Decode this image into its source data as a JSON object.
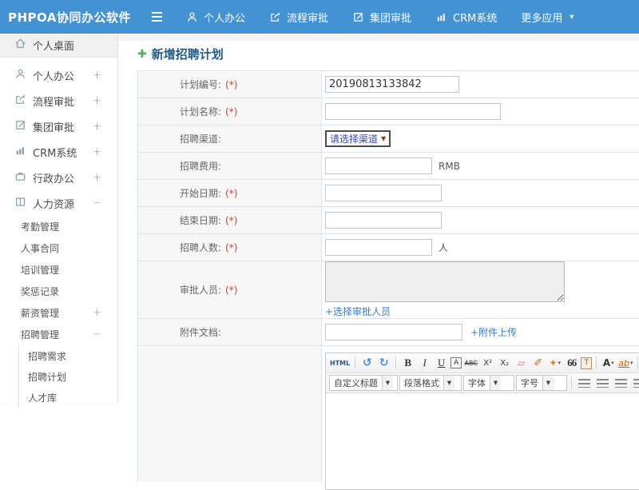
{
  "colors": {
    "topbar": "#4292d4",
    "link": "#3a7cc4",
    "title": "#235c88",
    "green": "#52b152",
    "required": "#e5342a"
  },
  "topbar": {
    "brand": "PHPOA协同办公软件",
    "items": [
      {
        "label": "个人办公"
      },
      {
        "label": "流程审批"
      },
      {
        "label": "集团审批"
      },
      {
        "label": "CRM系统"
      },
      {
        "label": "更多应用",
        "caret": "▾"
      }
    ]
  },
  "sidebar": {
    "items": [
      {
        "label": "个人桌面"
      },
      {
        "label": "个人办公",
        "expander": "+"
      },
      {
        "label": "流程审批",
        "expander": "+"
      },
      {
        "label": "集团审批",
        "expander": "+"
      },
      {
        "label": "CRM系统",
        "expander": "+"
      },
      {
        "label": "行政办公",
        "expander": "+"
      },
      {
        "label": "人力资源",
        "expander": "−"
      },
      {
        "label": "考勤管理"
      },
      {
        "label": "人事合同"
      },
      {
        "label": "培训管理"
      },
      {
        "label": "奖惩记录"
      },
      {
        "label": "薪资管理",
        "expander": "+"
      },
      {
        "label": "招聘管理",
        "expander": "−"
      },
      {
        "label": "招聘需求"
      },
      {
        "label": "招聘计划"
      },
      {
        "label": "人才库"
      }
    ]
  },
  "page": {
    "title": "新增招聘计划"
  },
  "form": {
    "required_mark": "(*)",
    "rows": [
      {
        "label": "计划编号:",
        "value": "20190813133842"
      },
      {
        "label": "计划名称:",
        "value": ""
      },
      {
        "label": "招聘渠道:",
        "select_value": "请选择渠道",
        "select_arrow": "▼"
      },
      {
        "label": "招聘费用:",
        "value": "",
        "suffix": "RMB"
      },
      {
        "label": "开始日期:",
        "value": ""
      },
      {
        "label": "结束日期:",
        "value": ""
      },
      {
        "label": "招聘人数:",
        "value": "",
        "suffix": "人"
      },
      {
        "label": "审批人员:",
        "link": "+选择审批人员"
      },
      {
        "label": "附件文档:",
        "value": "",
        "link": "+附件上传"
      }
    ]
  },
  "editor": {
    "row1": {
      "html": "HTML",
      "undo": "↺",
      "redo": "↻",
      "bold": "B",
      "italic": "I",
      "underline": "U",
      "border": "A",
      "strike": "ABC",
      "sup": "X²",
      "sub": "X₂",
      "eraser": "▱",
      "brush": "✐",
      "paint": "✦",
      "paint_caret": "▾",
      "quote": "66",
      "paste": "T",
      "fontcolor": "A",
      "fontcolor_caret": "▾",
      "highlight": "ab",
      "highlight_caret": "▾"
    },
    "combos": [
      {
        "label": "自定义标题",
        "caret": "▼"
      },
      {
        "label": "段落格式",
        "caret": "▼"
      },
      {
        "label": "字体",
        "caret": "▼"
      },
      {
        "label": "字号",
        "caret": "▼"
      }
    ],
    "link_glyph": "∞"
  }
}
